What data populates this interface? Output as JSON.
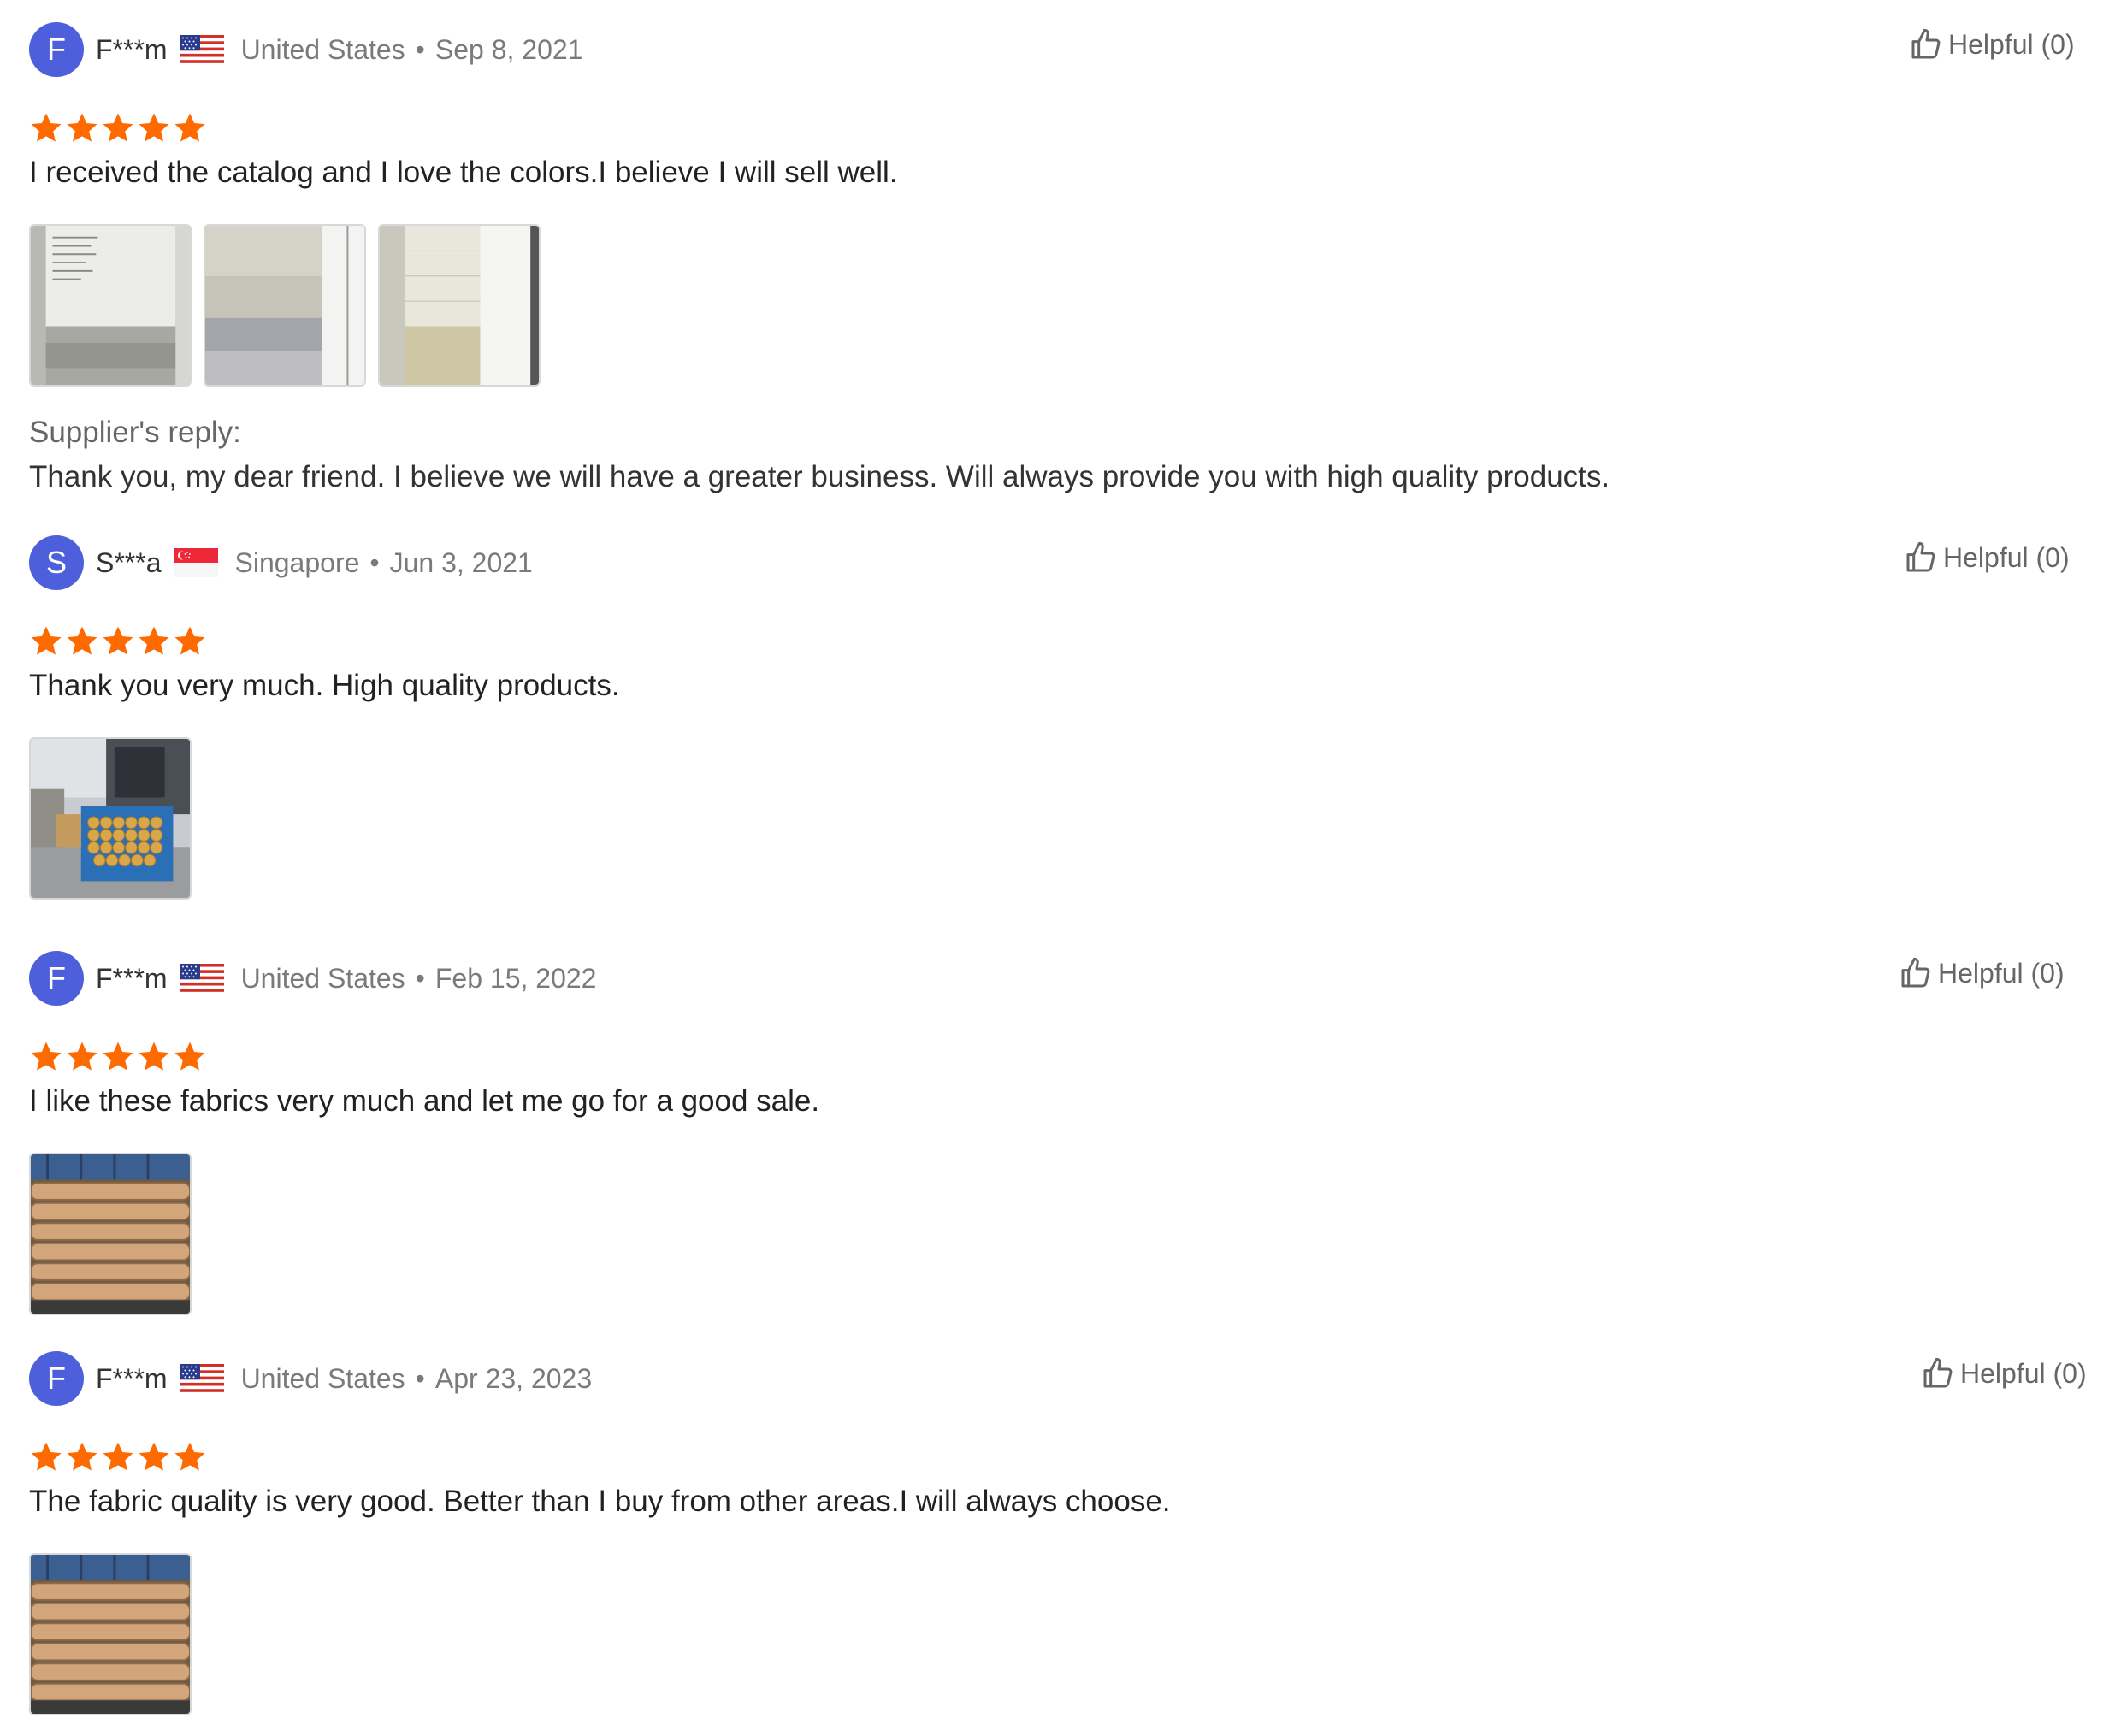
{
  "colors": {
    "star": "#ff6a00",
    "avatar": "#4d5fdb",
    "meta_text": "#7a7a7a"
  },
  "reviews": [
    {
      "avatar_letter": "F",
      "username": "F***m",
      "flag_icon": "us-flag-icon",
      "country": "United States",
      "separator": "•",
      "date": "Sep 8, 2021",
      "helpful_label": "Helpful (0)",
      "rating": 5,
      "text": "I received the catalog and I love the colors.I believe I will sell well.",
      "photos": [
        "catalog-photo-1",
        "catalog-photo-2",
        "catalog-photo-3"
      ],
      "supplier_reply": {
        "label": "Supplier's reply:",
        "text": "Thank you, my dear friend. I believe we will have a greater business. Will always provide you with high quality products."
      }
    },
    {
      "avatar_letter": "S",
      "username": "S***a",
      "flag_icon": "sg-flag-icon",
      "country": "Singapore",
      "separator": "•",
      "date": "Jun 3, 2021",
      "helpful_label": "Helpful (0)",
      "rating": 5,
      "text": "Thank you very much. High quality products.",
      "photos": [
        "warehouse-photo"
      ]
    },
    {
      "avatar_letter": "F",
      "username": "F***m",
      "flag_icon": "us-flag-icon",
      "country": "United States",
      "separator": "•",
      "date": "Feb 15, 2022",
      "helpful_label": "Helpful (0)",
      "rating": 5,
      "text": "I like these fabrics very much and let me go for a good sale.",
      "photos": [
        "fabric-rolls-photo"
      ]
    },
    {
      "avatar_letter": "F",
      "username": "F***m",
      "flag_icon": "us-flag-icon",
      "country": "United States",
      "separator": "•",
      "date": "Apr 23, 2023",
      "helpful_label": "Helpful (0)",
      "rating": 5,
      "text": "The fabric quality is very good. Better than I buy from other areas.I will always choose.",
      "photos": [
        "fabric-rolls-photo"
      ]
    }
  ]
}
